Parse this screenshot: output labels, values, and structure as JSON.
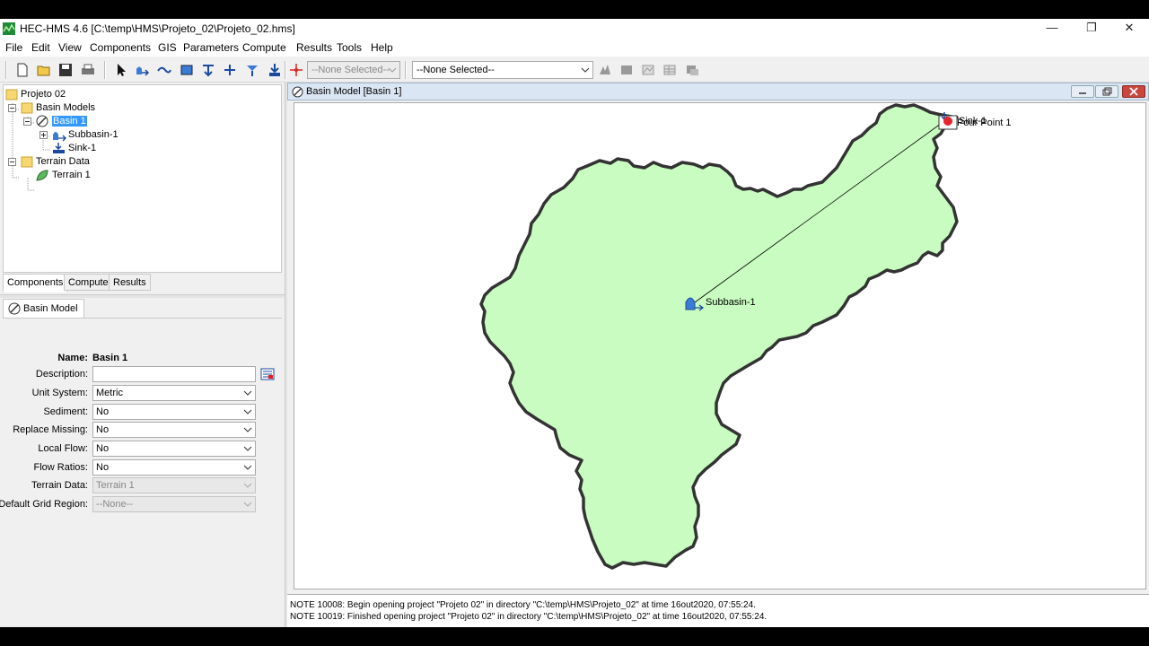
{
  "window": {
    "title": "HEC-HMS 4.6 [C:\\temp\\HMS\\Projeto_02\\Projeto_02.hms]",
    "min_glyph": "—",
    "restore_glyph": "❐",
    "close_glyph": "✕"
  },
  "menu": [
    "File",
    "Edit",
    "View",
    "Components",
    "GIS",
    "Parameters",
    "Compute",
    "Results",
    "Tools",
    "Help"
  ],
  "toolbar": {
    "selector1": "--None Selected--",
    "selector2": "--None Selected--"
  },
  "tree": {
    "project": "Projeto 02",
    "basin_models": "Basin Models",
    "basin1": "Basin 1",
    "subbasin1": "Subbasin-1",
    "sink1": "Sink-1",
    "terrain_data": "Terrain Data",
    "terrain1": "Terrain 1"
  },
  "tabs": [
    "Components",
    "Compute",
    "Results"
  ],
  "properties": {
    "tab_label": "Basin Model",
    "name_label": "Name:",
    "name_value": "Basin 1",
    "description_label": "Description:",
    "description_value": "",
    "unit_system_label": "Unit System:",
    "unit_system_value": "Metric",
    "sediment_label": "Sediment:",
    "sediment_value": "No",
    "replace_missing_label": "Replace Missing:",
    "replace_missing_value": "No",
    "local_flow_label": "Local Flow:",
    "local_flow_value": "No",
    "flow_ratios_label": "Flow Ratios:",
    "flow_ratios_value": "No",
    "terrain_data_label": "Terrain Data:",
    "terrain_data_value": "Terrain 1",
    "grid_region_label": "Default Grid Region:",
    "grid_region_value": "--None--"
  },
  "map_window": {
    "title": "Basin Model [Basin 1]",
    "subbasin_label": "Subbasin-1",
    "sink_label": "Sink-1",
    "pour_point_label": "Pour Point 1",
    "basin_fill": "#c8fcc0",
    "sink_color": "#e8232a"
  },
  "log": [
    "NOTE 10008:  Begin opening project \"Projeto 02\" in directory \"C:\\temp\\HMS\\Projeto_02\" at time 16out2020, 07:55:24.",
    "NOTE 10019:  Finished opening project \"Projeto 02\" in directory \"C:\\temp\\HMS\\Projeto_02\" at time 16out2020, 07:55:24."
  ]
}
